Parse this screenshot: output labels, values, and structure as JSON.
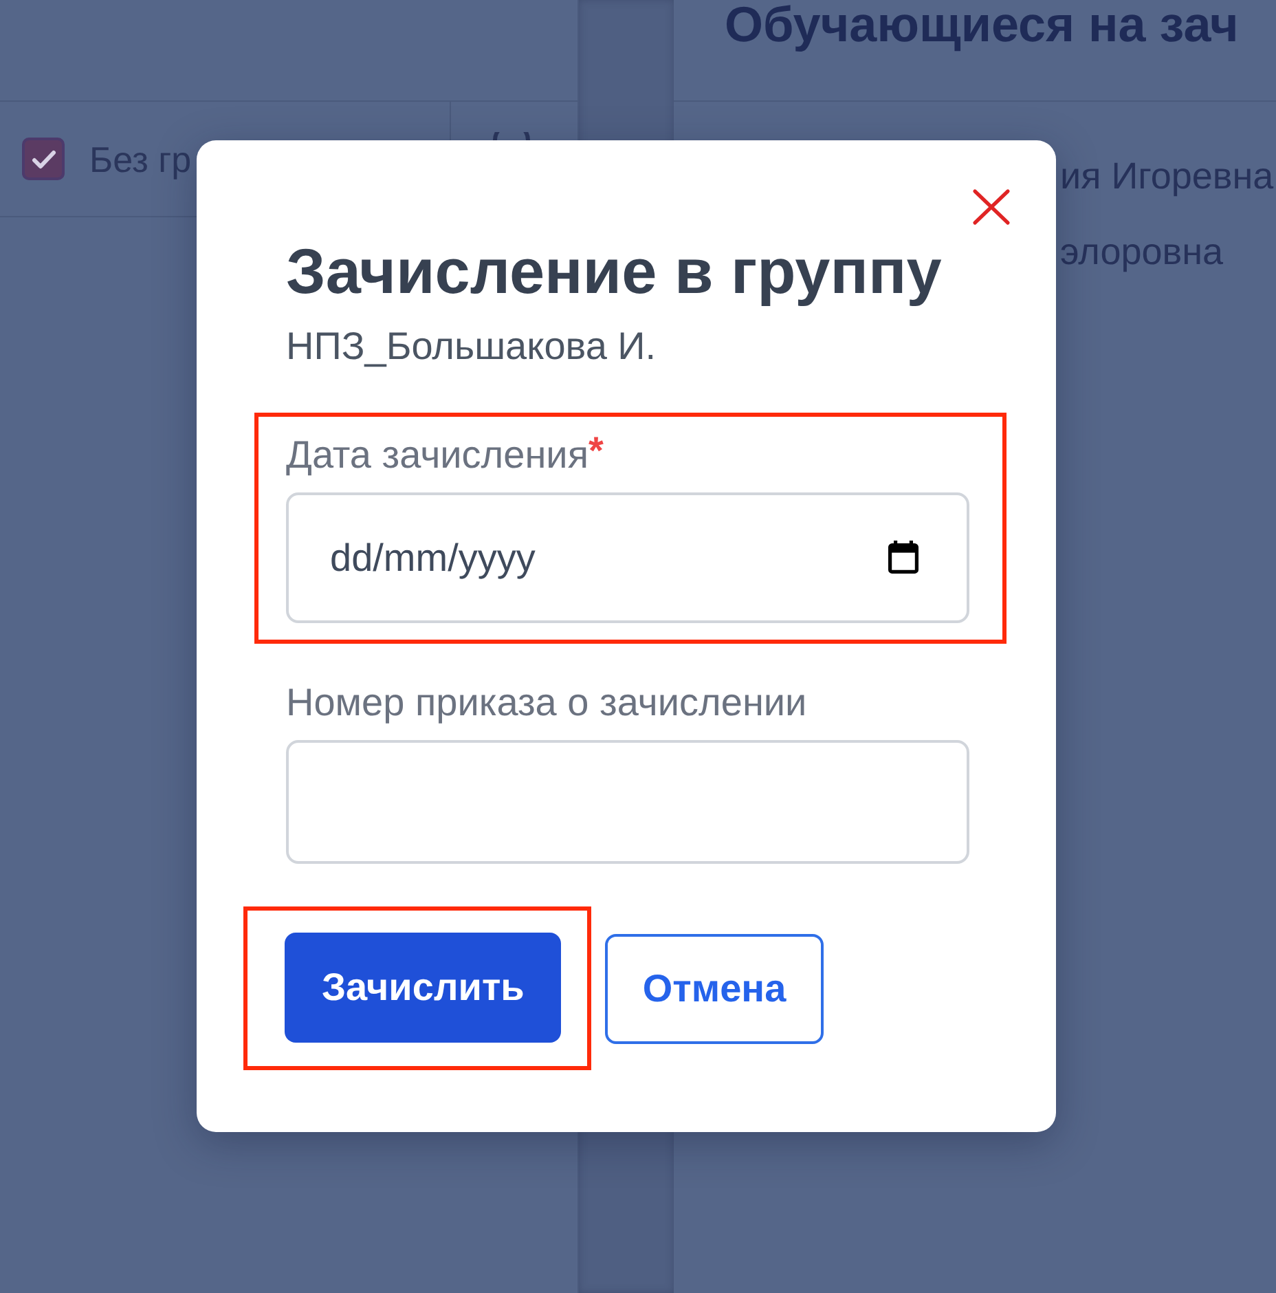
{
  "page": {
    "filter": {
      "label": "Без гр",
      "checked": true
    },
    "right_panel": {
      "title": "Обучающиеся на зач",
      "items": [
        "ия Игоревна",
        "элоровна"
      ]
    }
  },
  "dialog": {
    "title": "Зачисление в группу",
    "subtitle": "НПЗ_Большакова И.",
    "fields": [
      {
        "kind": "date",
        "label": "Дата зачисления",
        "required_mark": "*",
        "placeholder": "dd/mm/yyyy",
        "highlighted": true
      },
      {
        "kind": "text",
        "label": "Номер приказа о зачислении",
        "highlighted": false
      }
    ],
    "buttons": [
      {
        "kind": "primary",
        "label": "Зачислить",
        "highlighted": true
      },
      {
        "kind": "secondary",
        "label": "Отмена",
        "highlighted": false
      }
    ]
  }
}
